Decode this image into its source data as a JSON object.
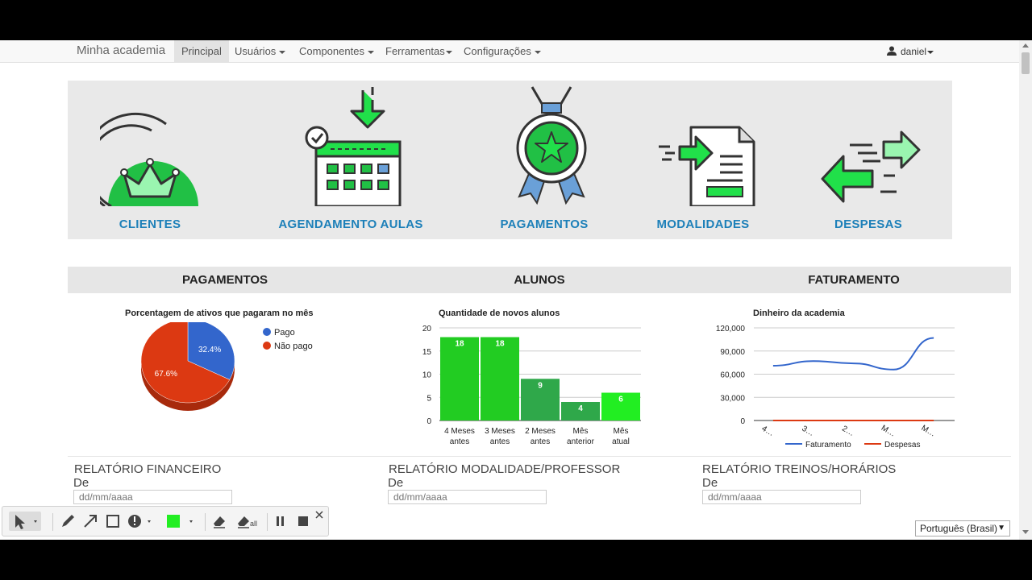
{
  "navbar": {
    "brand": "Minha academia",
    "items": [
      {
        "label": "Principal",
        "active": true
      },
      {
        "label": "Usuários"
      },
      {
        "label": "Componentes"
      },
      {
        "label": "Ferramentas"
      },
      {
        "label": "Configurações"
      }
    ],
    "user": "daniel"
  },
  "features": [
    {
      "label": "CLIENTES",
      "icon": "crown-icon"
    },
    {
      "label": "AGENDAMENTO AULAS",
      "icon": "calendar-icon"
    },
    {
      "label": "PAGAMENTOS",
      "icon": "medal-icon"
    },
    {
      "label": "MODALIDADES",
      "icon": "document-icon"
    },
    {
      "label": "DESPESAS",
      "icon": "arrows-icon"
    }
  ],
  "sections": {
    "pagamentos": "PAGAMENTOS",
    "alunos": "ALUNOS",
    "faturamento": "FATURAMENTO"
  },
  "colors": {
    "accent": "#1d80b9",
    "green": "#22cc22",
    "pago": "#3366cc",
    "nao_pago": "#dc3912"
  },
  "chart_data": [
    {
      "type": "pie",
      "title": "Porcentagem de ativos que pagaram no mês",
      "categories": [
        "Pago",
        "Não pago"
      ],
      "values": [
        32.4,
        67.6
      ],
      "labels": [
        "32.4%",
        "67.6%"
      ],
      "legend": "right"
    },
    {
      "type": "bar",
      "title": "Quantidade de novos alunos",
      "categories": [
        "4 Meses antes",
        "3 Meses antes",
        "2 Meses antes",
        "Mês anterior",
        "Mês atual"
      ],
      "category_lines": [
        [
          "4 Meses",
          "antes"
        ],
        [
          "3 Meses",
          "antes"
        ],
        [
          "2 Meses",
          "antes"
        ],
        [
          "Mês",
          "anterior"
        ],
        [
          "Mês",
          "atual"
        ]
      ],
      "values": [
        18,
        18,
        9,
        4,
        6
      ],
      "yticks": [
        "0",
        "5",
        "10",
        "15",
        "20"
      ],
      "ylim": [
        0,
        20
      ],
      "grid": true
    },
    {
      "type": "line",
      "title": "Dinheiro da academia",
      "x_ticks": [
        "4…",
        "3…",
        "2…",
        "M…",
        "M…"
      ],
      "yticks": [
        "0",
        "30,000",
        "60,000",
        "90,000",
        "120,000"
      ],
      "ylim": [
        0,
        120000
      ],
      "series": [
        {
          "name": "Faturamento",
          "values": [
            71000,
            77000,
            74000,
            66000,
            107000
          ]
        },
        {
          "name": "Despesas",
          "values": [
            0,
            0,
            0,
            0,
            0
          ]
        }
      ],
      "legend": "bottom",
      "grid": true
    }
  ],
  "reports": [
    {
      "title": "RELATÓRIO FINANCEIRO",
      "de": "De",
      "placeholder": "dd/mm/aaaa"
    },
    {
      "title": "RELATÓRIO MODALIDADE/PROFESSOR",
      "de": "De",
      "placeholder": "dd/mm/aaaa"
    },
    {
      "title": "RELATÓRIO TREINOS/HORÁRIOS",
      "de": "De",
      "placeholder": "dd/mm/aaaa"
    }
  ],
  "language": "Português (Brasil)",
  "toolbar": {
    "icons": [
      "pointer-icon",
      "pencil-icon",
      "arrow-icon",
      "rectangle-icon",
      "alert-icon",
      "color-swatch",
      "eraser-icon",
      "eraser-all-icon",
      "pause-icon",
      "stop-icon",
      "close-icon"
    ],
    "eraser_all_label": "all",
    "swatch_color": "#22ee22"
  }
}
